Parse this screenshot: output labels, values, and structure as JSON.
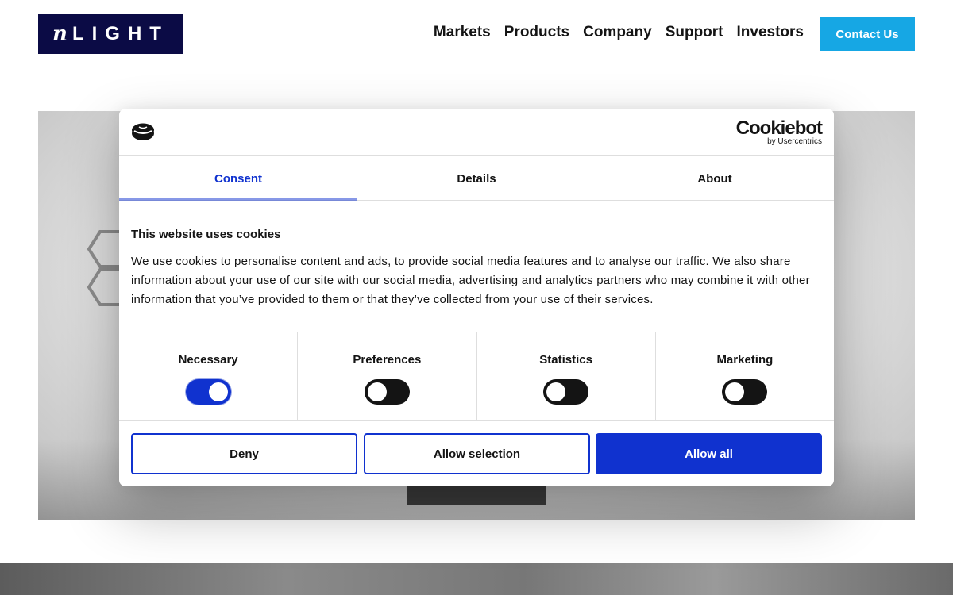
{
  "header": {
    "logo_prefix": "n",
    "logo_text": "LIGHT",
    "nav": [
      {
        "label": "Markets"
      },
      {
        "label": "Products"
      },
      {
        "label": "Company"
      },
      {
        "label": "Support"
      },
      {
        "label": "Investors"
      }
    ],
    "contact_label": "Contact Us",
    "colors": {
      "logo_bg": "#0b0b45",
      "contact_bg": "#16a7e4"
    }
  },
  "cookie_dialog": {
    "brand": {
      "name": "Cookiebot",
      "sub": "by Usercentrics"
    },
    "tabs": [
      {
        "label": "Consent",
        "active": true
      },
      {
        "label": "Details",
        "active": false
      },
      {
        "label": "About",
        "active": false
      }
    ],
    "title": "This website uses cookies",
    "body": "We use cookies to personalise content and ads, to provide social media features and to analyse our traffic. We also share information about your use of our site with our social media, advertising and analytics partners who may combine it with other information that you’ve provided to them or that they’ve collected from your use of their services.",
    "categories": [
      {
        "label": "Necessary",
        "enabled": true
      },
      {
        "label": "Preferences",
        "enabled": false
      },
      {
        "label": "Statistics",
        "enabled": false
      },
      {
        "label": "Marketing",
        "enabled": false
      }
    ],
    "buttons": {
      "deny": "Deny",
      "allow_selection": "Allow selection",
      "allow_all": "Allow all"
    },
    "colors": {
      "accent": "#1032cf"
    }
  }
}
